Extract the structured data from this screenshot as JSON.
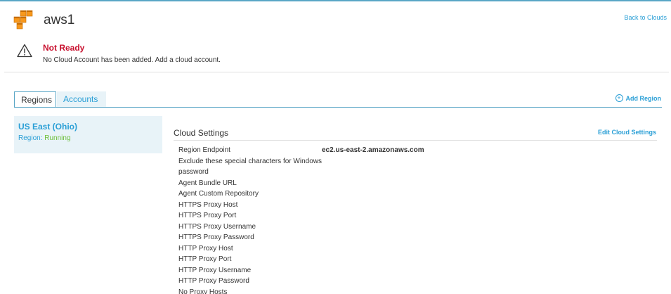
{
  "header": {
    "cloud_name": "aws1",
    "back_link": "Back to Clouds",
    "logo_icon": "aws-cubes-icon"
  },
  "status": {
    "icon": "warning-icon",
    "title": "Not Ready",
    "message": "No Cloud Account has been added. Add a cloud account."
  },
  "tabs": [
    {
      "label": "Regions",
      "active": true
    },
    {
      "label": "Accounts",
      "active": false
    }
  ],
  "add_region": {
    "label": "Add Region",
    "icon": "plus-circle-icon"
  },
  "region": {
    "name": "US East (Ohio)",
    "status_label": "Region:",
    "status_value": "Running"
  },
  "cloud_settings": {
    "title": "Cloud Settings",
    "edit_label": "Edit Cloud Settings",
    "rows": [
      {
        "key": "Region Endpoint",
        "value": "ec2.us-east-2.amazonaws.com"
      },
      {
        "key": "Exclude these special characters for Windows password",
        "value": ""
      },
      {
        "key": "Agent Bundle URL",
        "value": ""
      },
      {
        "key": "Agent Custom Repository",
        "value": ""
      },
      {
        "key": "HTTPS Proxy Host",
        "value": ""
      },
      {
        "key": "HTTPS Proxy Port",
        "value": ""
      },
      {
        "key": "HTTPS Proxy Username",
        "value": ""
      },
      {
        "key": "HTTPS Proxy Password",
        "value": ""
      },
      {
        "key": "HTTP Proxy Host",
        "value": ""
      },
      {
        "key": "HTTP Proxy Port",
        "value": ""
      },
      {
        "key": "HTTP Proxy Username",
        "value": ""
      },
      {
        "key": "HTTP Proxy Password",
        "value": ""
      },
      {
        "key": "No Proxy Hosts",
        "value": ""
      }
    ]
  },
  "colors": {
    "accent": "#2a9fd6",
    "error": "#c8102e",
    "success": "#6cbf3a",
    "aws_orange": "#f7981d"
  }
}
